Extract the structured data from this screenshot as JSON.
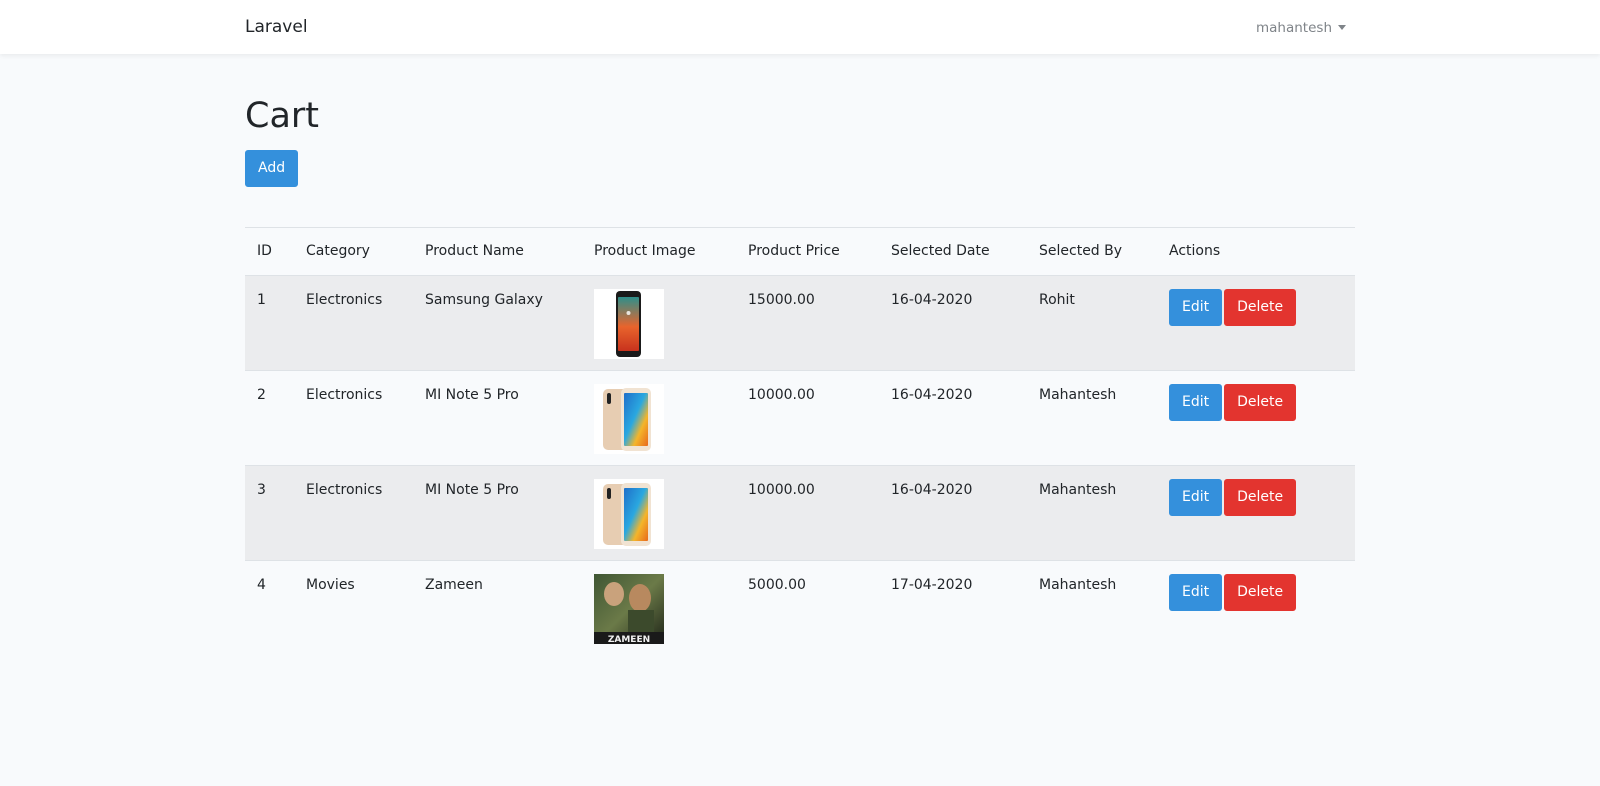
{
  "navbar": {
    "brand": "Laravel",
    "user": "mahantesh"
  },
  "page": {
    "title": "Cart",
    "add_label": "Add"
  },
  "table": {
    "headers": [
      "ID",
      "Category",
      "Product Name",
      "Product Image",
      "Product Price",
      "Selected Date",
      "Selected By",
      "Actions"
    ],
    "rows": [
      {
        "id": "1",
        "category": "Electronics",
        "product_name": "Samsung Galaxy",
        "image": "samsung-phone",
        "price": "15000.00",
        "date": "16-04-2020",
        "selected_by": "Rohit"
      },
      {
        "id": "2",
        "category": "Electronics",
        "product_name": "MI Note 5 Pro",
        "image": "mi-phone",
        "price": "10000.00",
        "date": "16-04-2020",
        "selected_by": "Mahantesh"
      },
      {
        "id": "3",
        "category": "Electronics",
        "product_name": "MI Note 5 Pro",
        "image": "mi-phone",
        "price": "10000.00",
        "date": "16-04-2020",
        "selected_by": "Mahantesh"
      },
      {
        "id": "4",
        "category": "Movies",
        "product_name": "Zameen",
        "image": "movie-poster",
        "price": "5000.00",
        "date": "17-04-2020",
        "selected_by": "Mahantesh"
      }
    ],
    "edit_label": "Edit",
    "delete_label": "Delete"
  },
  "poster_text": "ZAMEEN",
  "colors": {
    "primary": "#3490dc",
    "danger": "#e3342f",
    "background": "#f8fafc",
    "striped_row": "#ebecee"
  }
}
